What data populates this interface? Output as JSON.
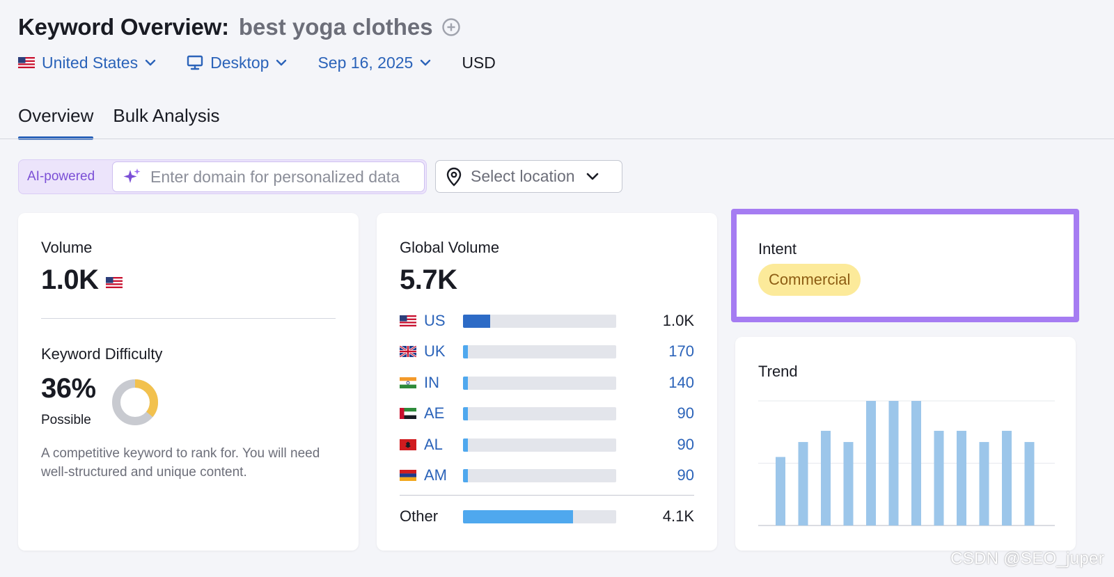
{
  "header": {
    "title": "Keyword Overview:",
    "keyword": "best yoga clothes",
    "add_icon": "plus-circle-icon"
  },
  "filters": {
    "country": "United States",
    "device": "Desktop",
    "date": "Sep 16, 2025",
    "currency": "USD"
  },
  "tabs": [
    {
      "label": "Overview",
      "active": true
    },
    {
      "label": "Bulk Analysis",
      "active": false
    }
  ],
  "ai_search": {
    "badge": "AI-powered",
    "placeholder": "Enter domain for personalized data"
  },
  "location_select": {
    "placeholder": "Select location"
  },
  "volume_card": {
    "label": "Volume",
    "value": "1.0K",
    "kd_label": "Keyword Difficulty",
    "kd_value": "36%",
    "kd_percent": 36,
    "kd_level": "Possible",
    "kd_description": "A competitive keyword to rank for. You will need well-structured and unique content."
  },
  "global_volume_card": {
    "label": "Global Volume",
    "value": "5.7K",
    "rows": [
      {
        "code": "US",
        "value": "1.0K",
        "share": 0.175,
        "flag": "us-flag-icon"
      },
      {
        "code": "UK",
        "value": "170",
        "share": 0.03,
        "flag": "uk-flag-icon"
      },
      {
        "code": "IN",
        "value": "140",
        "share": 0.025,
        "flag": "in-flag-icon"
      },
      {
        "code": "AE",
        "value": "90",
        "share": 0.02,
        "flag": "ae-flag-icon"
      },
      {
        "code": "AL",
        "value": "90",
        "share": 0.02,
        "flag": "al-flag-icon"
      },
      {
        "code": "AM",
        "value": "90",
        "share": 0.02,
        "flag": "am-flag-icon"
      }
    ],
    "other": {
      "label": "Other",
      "value": "4.1K",
      "share": 0.72
    }
  },
  "intent_card": {
    "label": "Intent",
    "badge": "Commercial"
  },
  "trend_card": {
    "label": "Trend"
  },
  "chart_data": {
    "type": "bar",
    "title": "Trend",
    "categories": [
      "1",
      "2",
      "3",
      "4",
      "5",
      "6",
      "7",
      "8",
      "9",
      "10",
      "11",
      "12"
    ],
    "values": [
      0.55,
      0.67,
      0.76,
      0.67,
      1.0,
      1.0,
      1.0,
      0.76,
      0.76,
      0.67,
      0.76,
      0.67
    ],
    "ylim": [
      0,
      1
    ],
    "grid": true
  },
  "colors": {
    "accent_blue": "#2b63b9",
    "intent_highlight": "#a57cf2",
    "intent_badge_bg": "#fcea9a",
    "trend_bar": "#9cc6ea",
    "kd_donut_fill": "#f2c14e",
    "kd_donut_track": "#c8cad0"
  },
  "watermark": "CSDN @SEO_juper"
}
